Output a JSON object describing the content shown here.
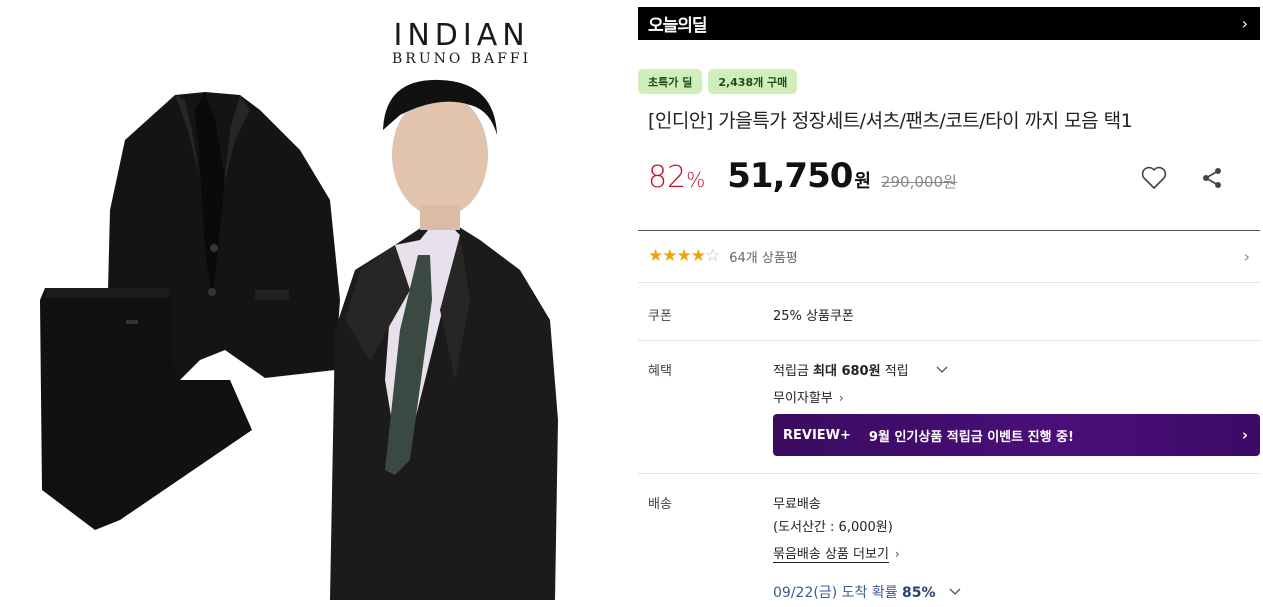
{
  "product_image": {
    "brand_main": "INDIAN",
    "brand_sub": "BRUNO BAFFI"
  },
  "deal_bar": {
    "title": "오늘의딜",
    "chevron": "›"
  },
  "badges": [
    "초특가 딜",
    "2,438개 구매"
  ],
  "product": {
    "title": "[인디안] 가을특가 정장세트/셔츠/팬츠/코트/타이 까지 모음 택1",
    "discount": "82",
    "discount_unit": "%",
    "price": "51,750",
    "price_unit": "원",
    "original_price": "290,000원"
  },
  "actions": {
    "like_icon": "heart-icon",
    "share_icon": "share-icon"
  },
  "rating": {
    "stars_filled": "★★★★",
    "stars_empty": "☆",
    "value": 4.5,
    "review_count": "64개 상품평"
  },
  "coupon": {
    "label": "쿠폰",
    "value": "25% 상품쿠폰"
  },
  "benefit": {
    "label": "혜택",
    "points_prefix": "적립금 ",
    "points_bold": "최대 680원",
    "points_suffix": " 적립",
    "installment": "무이자할부",
    "banner_tag": "REVIEW+",
    "banner_msg": "9월 인기상품 적립금 이벤트 진행 중!"
  },
  "shipping": {
    "label": "배송",
    "method": "무료배송",
    "remote_fee": "(도서산간 : 6,000원)",
    "bundle_link": "묶음배송 상품 더보기",
    "arrival_date": "09/22(금)",
    "arrival_text": " 도착 확률 ",
    "arrival_prob": "85%"
  },
  "colors": {
    "accent_red": "#c8102e",
    "badge_green": "#cfeebb",
    "banner_purple": "#4a0e7a"
  }
}
